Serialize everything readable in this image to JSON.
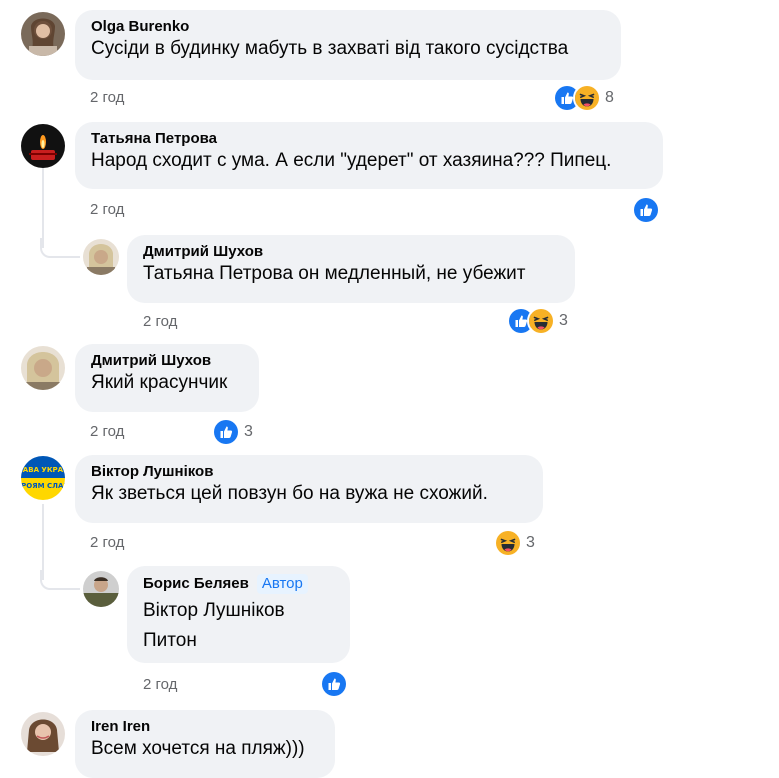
{
  "comments": [
    {
      "author": "Olga Burenko",
      "text": "Сусіди в будинку мабуть в захваті від такого сусідства",
      "time": "2 год",
      "reactions": [
        "like",
        "haha"
      ],
      "count": "8"
    },
    {
      "author": "Татьяна Петрова",
      "text": "Народ сходит с ума. А если \"удерет\" от хазяина??? Пипец.",
      "time": "2 год",
      "reactions": [
        "like"
      ],
      "count": "",
      "reply": {
        "author": "Дмитрий Шухов",
        "text": "Татьяна Петрова он медленный, не убежит",
        "time": "2 год",
        "reactions": [
          "like",
          "haha"
        ],
        "count": "3"
      }
    },
    {
      "author": "Дмитрий Шухов",
      "text": "Який красунчик",
      "time": "2 год",
      "reactions": [
        "like"
      ],
      "count": "3"
    },
    {
      "author": "Віктор Лушніков",
      "text": "Як зветься цей повзун бо на вужа не схожий.",
      "time": "2 год",
      "reactions": [
        "haha"
      ],
      "count": "3",
      "reply": {
        "author": "Борис Беляев",
        "badge": "Автор",
        "line1": "Віктор Лушніков",
        "line2": "Питон",
        "time": "2 год",
        "reactions": [
          "like"
        ],
        "count": ""
      }
    },
    {
      "author": "Iren Iren",
      "text": "Всем хочется на пляж)))"
    }
  ],
  "avatar_texts": {
    "flag_line1": "СЛАВА УКРАЇНІ",
    "flag_line2": "ГЕРОЯМ СЛАВА"
  },
  "colors": {
    "bubble": "#f0f2f5",
    "like": "#1877f2",
    "haha": "#f7b125",
    "meta": "#65676b",
    "flag_blue": "#0057b7",
    "flag_yellow": "#ffd700"
  }
}
